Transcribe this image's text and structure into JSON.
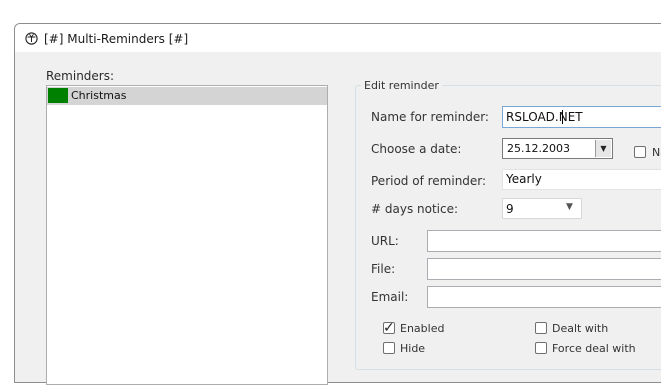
{
  "window": {
    "title": "[#] Multi-Reminders [#]",
    "icon": "reminder-app-icon"
  },
  "reminders": {
    "label": "Reminders:",
    "items": [
      {
        "name": "Christmas",
        "color": "#008000",
        "selected": true
      }
    ]
  },
  "edit": {
    "group_label": "Edit reminder",
    "name_label": "Name for reminder:",
    "name_value": "RSLOAD.NET",
    "date_label": "Choose a date:",
    "date_value": "25.12.2003",
    "date_extra_label": "No",
    "period_label": "Period of reminder:",
    "period_value": "Yearly",
    "days_label": "# days notice:",
    "days_value": "9",
    "url_label": "URL:",
    "url_value": "",
    "file_label": "File:",
    "file_value": "",
    "email_label": "Email:",
    "email_value": "",
    "enabled_label": "Enabled",
    "enabled_checked": true,
    "hide_label": "Hide",
    "hide_checked": false,
    "dealt_label": "Dealt with",
    "dealt_checked": false,
    "force_label": "Force deal with",
    "force_checked": false
  }
}
